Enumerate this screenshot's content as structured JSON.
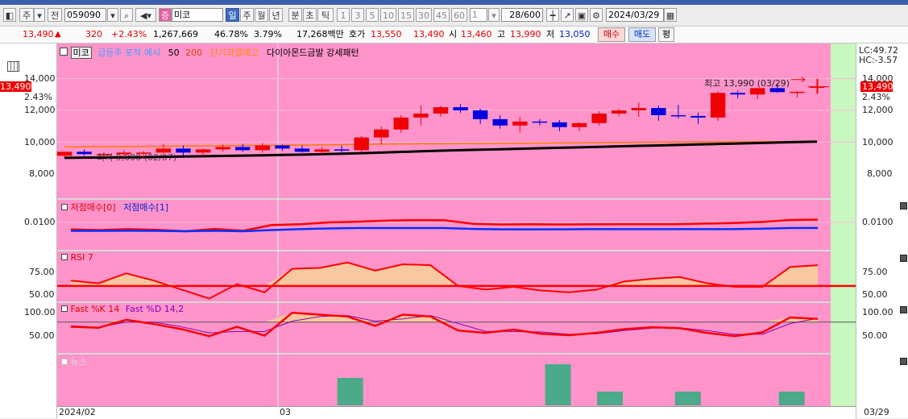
{
  "toolbar": {
    "period_label": "주",
    "prev_label": "전",
    "code": "059090",
    "name_badge": "증",
    "stock_name": "미코",
    "period_buttons": [
      "일",
      "주",
      "월",
      "년",
      "분",
      "초",
      "틱"
    ],
    "interval_buttons": [
      "1",
      "3",
      "5",
      "10",
      "15",
      "30",
      "45",
      "60"
    ],
    "custom_interval": "1",
    "count": "28",
    "count_max": "/600",
    "date": "2024/03/29"
  },
  "info": {
    "price": "13,490",
    "change": "320",
    "change_pct": "+2.43%",
    "volume": "1,267,669",
    "vol_pct": "46.78%",
    "turnover": "3.79%",
    "amount": "17,268백만",
    "ask_label": "호가",
    "ask_high": "13,550",
    "ask_low": "13,490",
    "open_label": "시",
    "open": "13,460",
    "high_label": "고",
    "high": "13,990",
    "low_label": "저",
    "low": "13,050",
    "buy_label": "매수",
    "sell_label": "매도",
    "eval_label": "평"
  },
  "price_panel": {
    "title": "미코",
    "indicator1": "급등주 포착 예시",
    "ma1": "50",
    "ma2": "200",
    "indicator2": "단기과열예고",
    "indicator3": "다이아몬드금발 강세패턴",
    "y_ticks": [
      "14,000",
      "12,000",
      "10,000",
      "8,000"
    ],
    "current_price": "13,490",
    "current_pct": "2.43%",
    "lc": "LC:49.72",
    "hc": "HC:-3.57",
    "high_annot": "최고 13,990 (03/29)",
    "low_annot": "최저 9,000 (02/07)"
  },
  "panel_lowbuy": {
    "series1": "저점매수[0]",
    "series2": "저점매수[1]",
    "y_tick": "0.0100"
  },
  "panel_rsi": {
    "title": "RSI 7",
    "y_ticks": [
      "75.00",
      "50.00"
    ]
  },
  "panel_stoch": {
    "k": "Fast %K 14",
    "d": "Fast %D 14,2",
    "y_ticks": [
      "100.00",
      "50.00"
    ]
  },
  "panel_news": {
    "title": "뉴스"
  },
  "x_axis": {
    "start": "2024/02",
    "mid": "03",
    "end": "03/29"
  },
  "colors": {
    "plot_bg": "#ff94cb",
    "up": "#f00000",
    "down": "#0000e0",
    "future": "#c8f7c0"
  },
  "chart_data": [
    {
      "type": "candlestick",
      "title": "미코",
      "x": [
        "02-01",
        "02-02",
        "02-05",
        "02-06",
        "02-07",
        "02-08",
        "02-13",
        "02-14",
        "02-15",
        "02-16",
        "02-19",
        "02-20",
        "02-21",
        "02-22",
        "02-23",
        "02-26",
        "02-27",
        "02-28",
        "02-29",
        "03-04",
        "03-05",
        "03-06",
        "03-07",
        "03-08",
        "03-11",
        "03-12",
        "03-13",
        "03-14",
        "03-15",
        "03-18",
        "03-19",
        "03-20",
        "03-21",
        "03-22",
        "03-25",
        "03-26",
        "03-27",
        "03-28",
        "03-29"
      ],
      "ohlc": [
        [
          9150,
          9400,
          9050,
          9400
        ],
        [
          9400,
          9550,
          9150,
          9250
        ],
        [
          9250,
          9350,
          9050,
          9250
        ],
        [
          9250,
          9500,
          9050,
          9350
        ],
        [
          9350,
          9450,
          9000,
          9350
        ],
        [
          9350,
          9900,
          9300,
          9600
        ],
        [
          9600,
          9800,
          9150,
          9350
        ],
        [
          9350,
          9600,
          9100,
          9550
        ],
        [
          9550,
          9850,
          9400,
          9700
        ],
        [
          9700,
          9900,
          9400,
          9500
        ],
        [
          9500,
          9950,
          9350,
          9800
        ],
        [
          9800,
          9850,
          9450,
          9600
        ],
        [
          9600,
          9800,
          9350,
          9400
        ],
        [
          9400,
          9700,
          9250,
          9550
        ],
        [
          9550,
          9800,
          9300,
          9500
        ],
        [
          9500,
          10400,
          9400,
          10300
        ],
        [
          10300,
          11000,
          9850,
          10800
        ],
        [
          10800,
          11700,
          10600,
          11550
        ],
        [
          11550,
          12300,
          11050,
          11800
        ],
        [
          11800,
          12300,
          11600,
          12200
        ],
        [
          12200,
          12400,
          11850,
          12000
        ],
        [
          12000,
          12100,
          11150,
          11450
        ],
        [
          11450,
          11700,
          10850,
          11050
        ],
        [
          11050,
          11600,
          10600,
          11300
        ],
        [
          11300,
          11450,
          11050,
          11250
        ],
        [
          11250,
          11400,
          10700,
          10950
        ],
        [
          10950,
          11250,
          10700,
          11200
        ],
        [
          11200,
          11950,
          11050,
          11800
        ],
        [
          11800,
          12100,
          11650,
          12000
        ],
        [
          12000,
          12500,
          11600,
          12150
        ],
        [
          12150,
          12300,
          11350,
          11700
        ],
        [
          11700,
          12350,
          11500,
          11650
        ],
        [
          11650,
          11850,
          11150,
          11550
        ],
        [
          11550,
          13200,
          11350,
          13100
        ],
        [
          13100,
          13250,
          12750,
          13000
        ],
        [
          13000,
          13400,
          12700,
          13400
        ],
        [
          13400,
          13700,
          13100,
          13150
        ],
        [
          13150,
          13200,
          12800,
          13170
        ],
        [
          13460,
          13990,
          13050,
          13490
        ]
      ],
      "series": [
        {
          "name": "50",
          "values": [
            9020,
            9030,
            9040,
            9050,
            9060,
            9080,
            9100,
            9120,
            9140,
            9160,
            9180,
            9200,
            9220,
            9250,
            9280,
            9310,
            9350,
            9390,
            9430,
            9470,
            9500,
            9530,
            9560,
            9590,
            9620,
            9650,
            9680,
            9710,
            9740,
            9770,
            9800,
            9830,
            9860,
            9890,
            9920,
            9950,
            9980,
            10010,
            10040
          ]
        },
        {
          "name": "200",
          "values": [
            9700,
            9710,
            9720,
            9730,
            9740,
            9750,
            9760,
            9770,
            9780,
            9790,
            9800,
            9810,
            9820,
            9830,
            9840,
            9860,
            9880,
            9890,
            9900,
            9900,
            9910,
            9920,
            9930,
            9940,
            9950,
            9960,
            9970,
            9980,
            9990,
            10000,
            10000,
            10010,
            10010,
            10020,
            10020,
            10030,
            10030,
            10040,
            10040
          ]
        }
      ],
      "ylim": [
        7500,
        15000
      ],
      "annotations": [
        "최고 13,990 (03/29)",
        "최저 9,000 (02/07)"
      ]
    },
    {
      "type": "line",
      "series": [
        {
          "name": "저점매수[0]",
          "values": [
            0.006,
            0.0057,
            0.0062,
            0.0058,
            0.005,
            0.0063,
            0.0053,
            0.0085,
            0.009,
            0.01,
            0.0104,
            0.011,
            0.0113,
            0.0112,
            0.0092,
            0.0088,
            0.009,
            0.0088,
            0.0089,
            0.009,
            0.009,
            0.009,
            0.0093,
            0.0096,
            0.0102,
            0.0113,
            0.0116
          ]
        },
        {
          "name": "저점매수[1]",
          "values": [
            0.0052,
            0.0052,
            0.0053,
            0.0052,
            0.005,
            0.0053,
            0.005,
            0.0057,
            0.0062,
            0.0066,
            0.0068,
            0.0068,
            0.0068,
            0.0068,
            0.0063,
            0.0061,
            0.0061,
            0.0061,
            0.0062,
            0.0062,
            0.0062,
            0.0062,
            0.0062,
            0.0062,
            0.0064,
            0.0068,
            0.0069
          ]
        }
      ],
      "ylim": [
        0.004,
        0.016
      ]
    },
    {
      "type": "line",
      "series": [
        {
          "name": "RSI 7",
          "values": [
            65,
            62,
            73,
            65,
            55,
            45,
            61,
            52,
            78,
            79,
            85,
            76,
            83,
            82,
            59,
            55,
            58,
            54,
            52,
            55,
            64,
            67,
            69,
            62,
            58,
            58,
            80,
            82
          ]
        }
      ],
      "reference": 59,
      "ylim": [
        40,
        95
      ]
    },
    {
      "type": "line",
      "series": [
        {
          "name": "Fast %K 14",
          "values": [
            68,
            66,
            83,
            74,
            63,
            48,
            68,
            49,
            98,
            94,
            90,
            70,
            94,
            90,
            60,
            55,
            62,
            53,
            50,
            55,
            63,
            67,
            65,
            55,
            48,
            56,
            88,
            85
          ]
        },
        {
          "name": "Fast %D 14,2",
          "values": [
            70,
            67,
            78,
            78,
            68,
            55,
            58,
            58,
            80,
            90,
            92,
            80,
            85,
            92,
            75,
            58,
            58,
            57,
            52,
            53,
            60,
            65,
            66,
            60,
            52,
            52,
            75,
            86
          ]
        }
      ],
      "reference": 78,
      "ylim": [
        20,
        120
      ]
    },
    {
      "type": "bar",
      "title": "뉴스",
      "values": [
        0,
        0,
        0,
        0,
        0,
        0,
        0,
        0,
        0,
        0,
        0,
        2,
        0,
        0,
        0,
        0,
        0,
        0,
        0,
        3,
        0,
        1,
        0,
        0,
        1,
        0,
        0,
        0,
        1,
        0
      ]
    }
  ]
}
